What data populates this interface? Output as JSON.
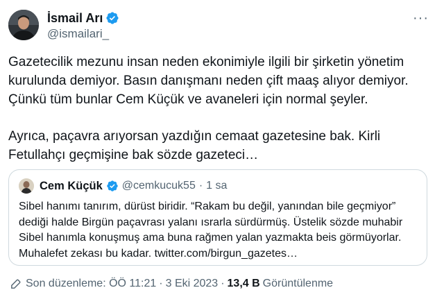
{
  "author": {
    "display_name": "İsmail Arı",
    "handle": "@ismailari_"
  },
  "menu": {
    "more_label": "···"
  },
  "tweet": {
    "paragraph1": "Gazetecilik mezunu insan neden ekonimiyle ilgili bir şirketin yönetim kurulunda demiyor. Basın danışmanı neden çift maaş alıyor demiyor. Çünkü tüm bunlar Cem Küçük ve avaneleri için normal şeyler.",
    "paragraph2": "Ayrıca, paçavra arıyorsan yazdığın cemaat gazetesine bak. Kirli Fetullahçı geçmişine bak sözde gazeteci…"
  },
  "quote": {
    "display_name": "Cem Küçük",
    "handle": "@cemkucuk55",
    "separator": "·",
    "time": "1 sa",
    "text": "Sibel hanımı tanırım, dürüst biridir. “Rakam bu değil, yanından bile geçmiyor” dediği halde Birgün paçavrası yalanı ısrarla sürdürmüş. Üstelik sözde muhabir Sibel hanımla konuşmuş ama buna rağmen yalan yazmakta beis görmüyorlar. Muhalefet zekası bu kadar. twitter.com/birgun_gazetes…"
  },
  "footer": {
    "edited_label": "Son düzenleme: ÖÖ 11:21",
    "separator": "·",
    "date": "3 Eki 2023",
    "views_count": "13,4 B",
    "views_label": "Görüntülenme"
  },
  "colors": {
    "verified_blue": "#1d9bf0",
    "text_primary": "#0f1419",
    "text_secondary": "#536471",
    "border": "#cfd9de"
  },
  "icons": {
    "verified": "verified-badge-icon",
    "more": "more-horizontal-icon",
    "edit": "pencil-icon"
  }
}
